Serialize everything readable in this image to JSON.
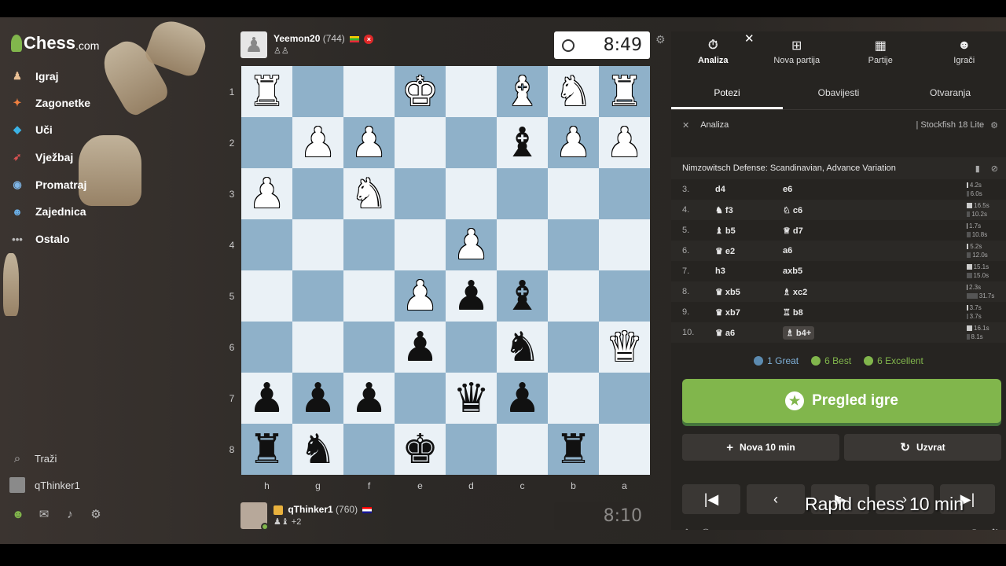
{
  "sidebar": {
    "logo": "Chess",
    "logo_suffix": ".com",
    "items": [
      {
        "label": "Igraj",
        "icon": "play-icon",
        "color": "#e8bf94"
      },
      {
        "label": "Zagonetke",
        "icon": "puzzle-icon",
        "color": "#f08040"
      },
      {
        "label": "Uči",
        "icon": "learn-icon",
        "color": "#3bb3e6"
      },
      {
        "label": "Vježbaj",
        "icon": "practice-icon",
        "color": "#d85252"
      },
      {
        "label": "Promatraj",
        "icon": "watch-icon",
        "color": "#7fb5e6"
      },
      {
        "label": "Zajednica",
        "icon": "community-icon",
        "color": "#6bb0e8"
      },
      {
        "label": "Ostalo",
        "icon": "more-icon",
        "color": "#bbbbbb"
      }
    ],
    "search": "Traži",
    "username": "qThinker1"
  },
  "top_player": {
    "name": "Yeemon20",
    "rating": "(744)",
    "clock": "8:49"
  },
  "bottom_player": {
    "name": "qThinker1",
    "rating": "(760)",
    "captured": "+2",
    "clock": "8:10"
  },
  "board": {
    "ranks": [
      "1",
      "2",
      "3",
      "4",
      "5",
      "6",
      "7",
      "8"
    ],
    "files": [
      "h",
      "g",
      "f",
      "e",
      "d",
      "c",
      "b",
      "a"
    ],
    "rows": [
      [
        "wR",
        "",
        "",
        "wK",
        "",
        "wB",
        "wN",
        "wR"
      ],
      [
        "",
        "wP",
        "wP",
        "",
        "",
        "bB",
        "wP",
        "wP"
      ],
      [
        "wP",
        "",
        "wN",
        "",
        "",
        "",
        "",
        ""
      ],
      [
        "",
        "",
        "",
        "",
        "wP",
        "",
        "",
        ""
      ],
      [
        "",
        "",
        "",
        "wP",
        "bP",
        "bB",
        "",
        ""
      ],
      [
        "",
        "",
        "",
        "bP",
        "",
        "bN",
        "",
        "wQ"
      ],
      [
        "bP",
        "bP",
        "bP",
        "",
        "bQ",
        "bP",
        "",
        ""
      ],
      [
        "bR",
        "bN",
        "",
        "bK",
        "",
        "",
        "bR",
        ""
      ]
    ]
  },
  "panel": {
    "nav": [
      {
        "label": "Analiza",
        "icon": "stopwatch-icon"
      },
      {
        "label": "Nova partija",
        "icon": "plus-icon"
      },
      {
        "label": "Partije",
        "icon": "board-icon"
      },
      {
        "label": "Igrači",
        "icon": "players-icon"
      }
    ],
    "tabs": [
      "Potezi",
      "Obavijesti",
      "Otvaranja"
    ],
    "engine_label": "Analiza",
    "engine_name": "Stockfish 18 Lite",
    "opening": "Nimzowitsch Defense: Scandinavian, Advance Variation",
    "moves": [
      {
        "n": "3.",
        "w": "d4",
        "b": "e6",
        "tw": "4.2s",
        "tb": "6.0s"
      },
      {
        "n": "4.",
        "w": "♞ f3",
        "b": "♘ c6",
        "tw": "16.5s",
        "tb": "10.2s"
      },
      {
        "n": "5.",
        "w": "♝ b5",
        "b": "♕ d7",
        "tw": "1.7s",
        "tb": "10.8s"
      },
      {
        "n": "6.",
        "w": "♛ e2",
        "b": "a6",
        "tw": "5.2s",
        "tb": "12.0s"
      },
      {
        "n": "7.",
        "w": "h3",
        "b": "axb5",
        "tw": "15.1s",
        "tb": "15.0s"
      },
      {
        "n": "8.",
        "w": "♛ xb5",
        "b": "♗ xc2",
        "tw": "2.3s",
        "tb": "31.7s"
      },
      {
        "n": "9.",
        "w": "♛ xb7",
        "b": "♖ b8",
        "tw": "3.7s",
        "tb": "3.7s"
      },
      {
        "n": "10.",
        "w": "♛ a6",
        "b": "♗ b4+",
        "tw": "16.1s",
        "tb": "8.1s"
      }
    ],
    "summary": [
      {
        "label": "1 Great",
        "color": "#5c8bb0"
      },
      {
        "label": "6 Best",
        "color": "#81b64c"
      },
      {
        "label": "6 Excellent",
        "color": "#81b64c"
      }
    ],
    "review_button": "Pregled igre",
    "new_game_button": "Nova 10 min",
    "rematch_button": "Uzvrat"
  },
  "caption": "Rapid chess 10 min"
}
